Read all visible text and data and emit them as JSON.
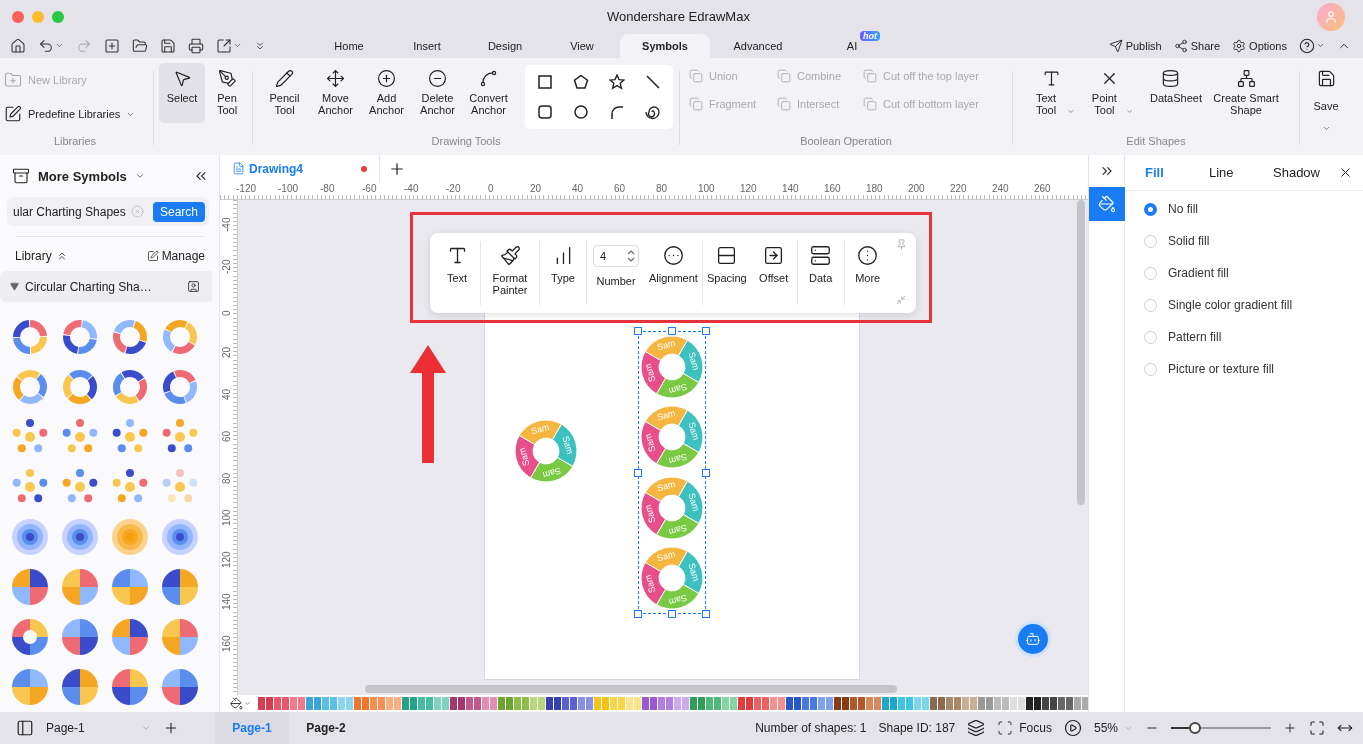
{
  "window": {
    "title": "Wondershare EdrawMax"
  },
  "menu_tabs": [
    {
      "label": "Home",
      "selected": false
    },
    {
      "label": "Insert",
      "selected": false
    },
    {
      "label": "Design",
      "selected": false
    },
    {
      "label": "View",
      "selected": false
    },
    {
      "label": "Symbols",
      "selected": true
    },
    {
      "label": "Advanced",
      "selected": false
    },
    {
      "label": "AI",
      "selected": false,
      "badge": "hot"
    }
  ],
  "header_actions": [
    {
      "label": "Publish"
    },
    {
      "label": "Share"
    },
    {
      "label": "Options"
    }
  ],
  "ribbon": {
    "libraries": {
      "title": "Libraries",
      "items": [
        {
          "label": "New Library",
          "disabled": true
        },
        {
          "label": "Predefine Libraries",
          "disabled": false
        }
      ]
    },
    "select_tools": [
      {
        "label": "Select",
        "selected": true
      },
      {
        "label": "Pen Tool",
        "selected": false
      }
    ],
    "drawing_tools": {
      "title": "Drawing Tools",
      "items": [
        {
          "label": "Pencil Tool"
        },
        {
          "label": "Move Anchor"
        },
        {
          "label": "Add Anchor"
        },
        {
          "label": "Delete Anchor"
        },
        {
          "label": "Convert Anchor"
        }
      ]
    },
    "boolean": {
      "title": "Boolean Operation",
      "items": [
        {
          "label": "Union",
          "disabled": true
        },
        {
          "label": "Combine",
          "disabled": true
        },
        {
          "label": "Cut off the top layer",
          "disabled": true
        },
        {
          "label": "Fragment",
          "disabled": true
        },
        {
          "label": "Intersect",
          "disabled": true
        },
        {
          "label": "Cut off bottom layer",
          "disabled": true
        }
      ]
    },
    "edit_shapes": {
      "title": "Edit Shapes",
      "items": [
        {
          "label": "Text Tool",
          "dropdown": true
        },
        {
          "label": "Point Tool",
          "dropdown": true
        },
        {
          "label": "DataSheet",
          "dropdown": false
        },
        {
          "label": "Create Smart Shape",
          "dropdown": false
        }
      ]
    },
    "save": {
      "label": "Save"
    }
  },
  "left_panel": {
    "title": "More Symbols",
    "search": {
      "value": "ular Charting Shapes",
      "button": "Search"
    },
    "library_label": "Library",
    "manage": "Manage",
    "section": {
      "title": "Circular Charting Sha…",
      "expanded": true
    }
  },
  "doc_tabs": [
    {
      "label": "Drawing4",
      "unsaved": true
    }
  ],
  "ruler": {
    "horizontal": [
      "-120",
      "-100",
      "-80",
      "-60",
      "-40",
      "-20",
      "0",
      "20",
      "40",
      "60",
      "80",
      "100",
      "120",
      "140",
      "160",
      "180",
      "200",
      "220",
      "240",
      "260"
    ],
    "vertical": [
      "-40",
      "-20",
      "0",
      "20",
      "40",
      "60",
      "80",
      "100",
      "120",
      "140",
      "160"
    ]
  },
  "floating_toolbar": {
    "groups": [
      [
        {
          "kind": "button",
          "label": "Text"
        }
      ],
      [
        {
          "kind": "button",
          "label": "Format Painter"
        }
      ],
      [
        {
          "kind": "button",
          "label": "Type"
        }
      ],
      [
        {
          "kind": "spinner",
          "value": "4",
          "label": "Number"
        },
        {
          "kind": "button",
          "label": "Alignment"
        }
      ],
      [
        {
          "kind": "button",
          "label": "Spacing"
        },
        {
          "kind": "button",
          "label": "Offset"
        }
      ],
      [
        {
          "kind": "button",
          "label": "Data"
        }
      ],
      [
        {
          "kind": "button",
          "label": "More"
        }
      ]
    ]
  },
  "canvas": {
    "shapes": [
      {
        "kind": "single",
        "selected": false,
        "labels": [
          "Sam",
          "Sam",
          "Sam",
          "Sam"
        ]
      },
      {
        "kind": "group",
        "selected": true,
        "items": [
          {
            "labels": [
              "Sam",
              "Sam",
              "Sam",
              "Sam"
            ]
          },
          {
            "labels": [
              "Sam",
              "Sam",
              "Sam",
              "Sam"
            ]
          },
          {
            "labels": [
              "Sam",
              "Sam",
              "Sam",
              "Sam"
            ]
          },
          {
            "labels": [
              "Sam",
              "Sam",
              "Sam",
              "Sam"
            ]
          }
        ]
      }
    ]
  },
  "right_panel": {
    "tabs": [
      {
        "label": "Fill",
        "selected": true
      },
      {
        "label": "Line",
        "selected": false
      },
      {
        "label": "Shadow",
        "selected": false
      }
    ],
    "options": [
      {
        "label": "No fill",
        "selected": true
      },
      {
        "label": "Solid fill",
        "selected": false
      },
      {
        "label": "Gradient fill",
        "selected": false
      },
      {
        "label": "Single color gradient fill",
        "selected": false
      },
      {
        "label": "Pattern fill",
        "selected": false
      },
      {
        "label": "Picture or texture fill",
        "selected": false
      }
    ]
  },
  "status_bar": {
    "page_select": "Page-1",
    "pages": [
      {
        "label": "Page-1",
        "selected": true
      },
      {
        "label": "Page-2",
        "selected": false
      }
    ],
    "shape_count": "Number of shapes: 1",
    "shape_id": "Shape ID: 187",
    "focus": "Focus",
    "zoom": "55%",
    "zoom_slider": {
      "level": 0.2
    }
  }
}
